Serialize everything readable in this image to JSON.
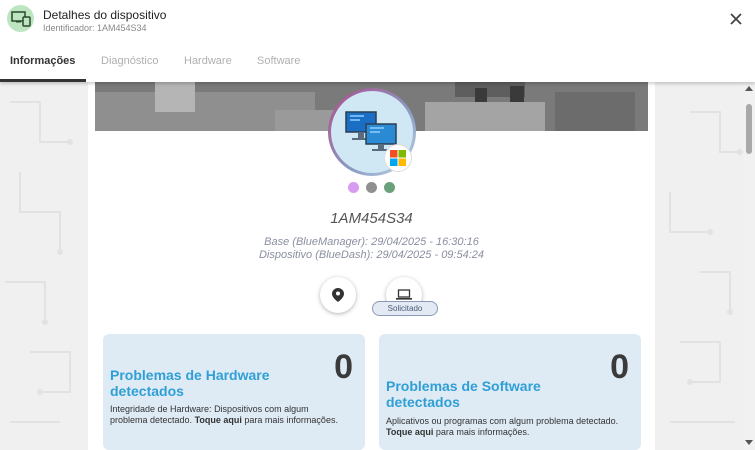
{
  "header": {
    "title": "Detalhes do dispositivo",
    "subtitle": "Identificador: 1AM454S34",
    "app_icon": "devices-icon",
    "close_icon": "close-icon"
  },
  "tabs": [
    {
      "label": "Informações",
      "active": true
    },
    {
      "label": "Diagnóstico",
      "active": false
    },
    {
      "label": "Hardware",
      "active": false
    },
    {
      "label": "Software",
      "active": false
    }
  ],
  "device": {
    "id": "1AM454S34",
    "base_sync": "Base (BlueManager): 29/04/2025 - 16:30:16",
    "device_sync": "Dispositivo (BlueDash): 29/04/2025 - 09:54:24",
    "os_icon": "windows-logo-icon",
    "avatar_icon": "monitors-icon",
    "dot_colors": [
      "#d79bf0",
      "#909090",
      "#6aa07a"
    ]
  },
  "actions": {
    "location_icon": "map-pin-icon",
    "laptop_icon": "laptop-icon",
    "status_badge": "Solicitado"
  },
  "problems": {
    "hardware": {
      "count": "0",
      "title": "Problemas de Hardware detectados",
      "desc_prefix": "Integridade de Hardware: Dispositivos com algum problema detectado. ",
      "desc_bold": "Toque aqui",
      "desc_suffix": " para mais informações."
    },
    "software": {
      "count": "0",
      "title": "Problemas de Software detectados",
      "desc_prefix": "Aplicativos ou programas com algum problema detectado. ",
      "desc_bold": "Toque aqui",
      "desc_suffix": " para mais informações."
    }
  },
  "colors": {
    "accent_blue": "#2f9fd6",
    "card_bg": "#deebf5",
    "app_icon_bg": "#bde5c0"
  }
}
